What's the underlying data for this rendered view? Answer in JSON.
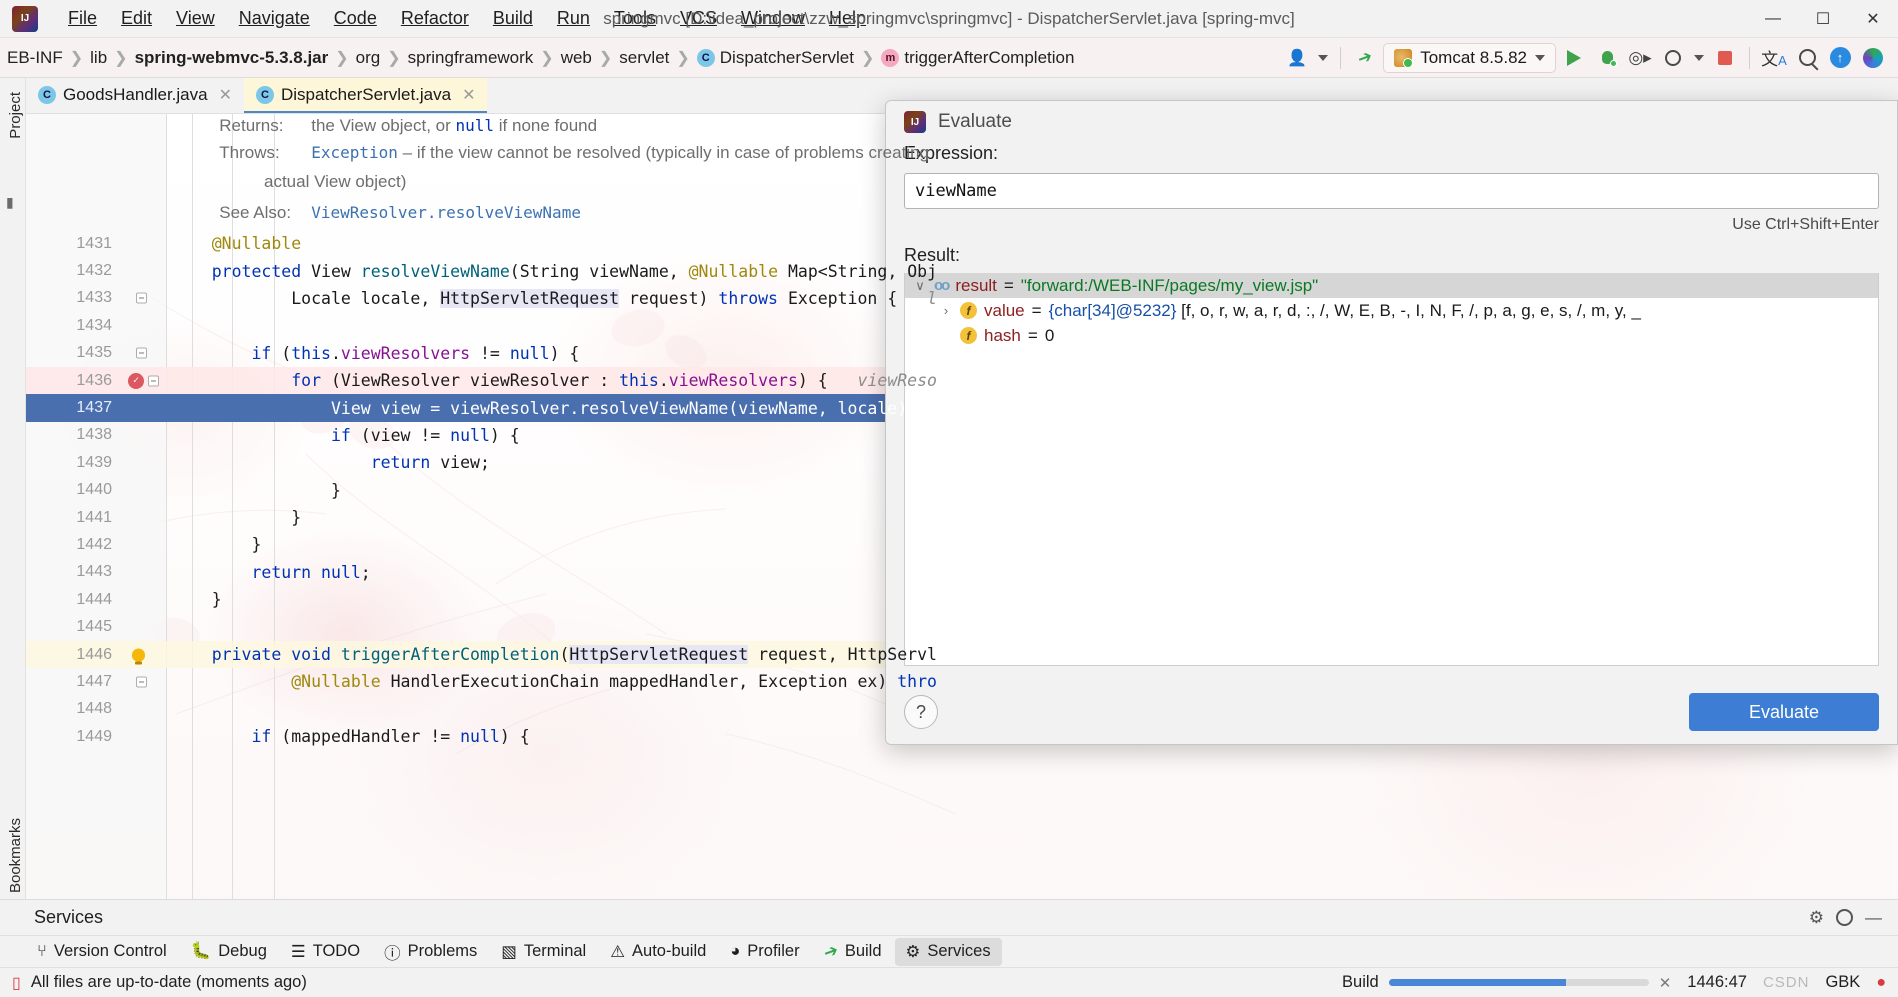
{
  "window": {
    "title": "springmvc [D:\\idea_project\\zzw_springmvc\\springmvc] - DispatcherServlet.java [spring-mvc]",
    "minimize": "—",
    "maximize": "☐",
    "close": "✕"
  },
  "menu": [
    "File",
    "Edit",
    "View",
    "Navigate",
    "Code",
    "Refactor",
    "Build",
    "Run",
    "Tools",
    "VCS",
    "Window",
    "Help"
  ],
  "breadcrumb": [
    {
      "label": "EB-INF",
      "icon": "",
      "bold": false
    },
    {
      "label": "lib",
      "icon": "",
      "bold": false
    },
    {
      "label": "spring-webmvc-5.3.8.jar",
      "icon": "",
      "bold": true
    },
    {
      "label": "org",
      "icon": "",
      "bold": false
    },
    {
      "label": "springframework",
      "icon": "",
      "bold": false
    },
    {
      "label": "web",
      "icon": "",
      "bold": false
    },
    {
      "label": "servlet",
      "icon": "",
      "bold": false
    },
    {
      "label": "DispatcherServlet",
      "icon": "c",
      "bold": false
    },
    {
      "label": "triggerAfterCompletion",
      "icon": "m",
      "bold": false
    }
  ],
  "toolbar": {
    "run_config": "Tomcat 8.5.82",
    "icons": [
      "user-icon",
      "hammer-icon",
      "run-icon",
      "debug-icon",
      "run-coverage-icon",
      "profiler-icon",
      "stop-icon",
      "translate-icon",
      "search-everywhere-icon",
      "update-project-icon",
      "plugin-icon"
    ]
  },
  "left_strip": {
    "top_tab": "Project",
    "bottom_tab": "Bookmarks"
  },
  "editor_tabs": [
    {
      "label": "GoodsHandler.java",
      "icon": "class-icon",
      "active": false
    },
    {
      "label": "DispatcherServlet.java",
      "icon": "class-icon",
      "active": true
    }
  ],
  "code": {
    "doc_lines": [
      {
        "type": "doc",
        "num": "",
        "segments": [
          {
            "t": "Returns:",
            "c": "doc-label",
            "indent": 3
          },
          {
            "t": "the View object, or null if none found",
            "c": "doc-label",
            "indent": 1
          }
        ]
      },
      {
        "type": "doc",
        "num": "",
        "segments": [
          {
            "t": "Throws:",
            "c": "doc-label",
            "indent": 3
          },
          {
            "t": "Exception",
            "c": "doc-link",
            "indent": 1
          },
          {
            "t": " – if the view cannot be resolved (typically in case of problems creating",
            "c": "doc-label",
            "indent": 0
          }
        ]
      },
      {
        "type": "doc",
        "num": "",
        "segments": [
          {
            "t": "actual View object)",
            "c": "doc-label",
            "indent": 9
          }
        ]
      },
      {
        "type": "doc",
        "num": "",
        "segments": [
          {
            "t": "See Also:",
            "c": "doc-label",
            "indent": 3
          },
          {
            "t": "ViewResolver.resolveViewName",
            "c": "doc-link",
            "indent": 1
          }
        ]
      }
    ],
    "lines": [
      {
        "num": "1431",
        "hl": "",
        "gutter": "",
        "html": "    <span class='ann'>@Nullable</span>"
      },
      {
        "num": "1432",
        "hl": "",
        "gutter": "",
        "html": "    <span class='kw'>protected</span> <span class='typ'>View</span> <span class='mth'>resolveViewName</span>(<span class='typ'>String</span> viewName, <span class='ann'>@Nullable</span> <span class='typ'>Map</span>&lt;<span class='typ'>String</span>, <span class='typ'>Obj</span>"
      },
      {
        "num": "1433",
        "hl": "",
        "gutter": "fold",
        "html": "            <span class='typ'>Locale</span> locale, <span class='hlref'>HttpServletRequest</span> request) <span class='kw'>throws</span> <span class='typ'>Exception</span> {   <span class='cmt'>l</span>"
      },
      {
        "num": "1434",
        "hl": "",
        "gutter": "",
        "html": ""
      },
      {
        "num": "1435",
        "hl": "",
        "gutter": "fold",
        "html": "        <span class='kw'>if</span> (<span class='kw'>this</span>.<span class='fld'>viewResolvers</span> != <span class='kw'>null</span>) {"
      },
      {
        "num": "1436",
        "hl": "pink",
        "gutter": "breakpoint-fold",
        "html": "            <span class='kw'>for</span> (<span class='typ'>ViewResolver</span> viewResolver : <span class='kw'>this</span>.<span class='fld'>viewResolvers</span>) {   <span class='cmt'>viewReso</span>"
      },
      {
        "num": "1437",
        "hl": "exec",
        "gutter": "",
        "html": "                <span class='typ'>View</span> view = viewResolver.<span class='mth'>resolveViewName</span>(viewName, locale);"
      },
      {
        "num": "1438",
        "hl": "",
        "gutter": "",
        "html": "                <span class='kw'>if</span> (view != <span class='kw'>null</span>) {"
      },
      {
        "num": "1439",
        "hl": "",
        "gutter": "",
        "html": "                    <span class='kw'>return</span> view;"
      },
      {
        "num": "1440",
        "hl": "",
        "gutter": "",
        "html": "                }"
      },
      {
        "num": "1441",
        "hl": "",
        "gutter": "",
        "html": "            }"
      },
      {
        "num": "1442",
        "hl": "",
        "gutter": "",
        "html": "        }"
      },
      {
        "num": "1443",
        "hl": "",
        "gutter": "",
        "html": "        <span class='kw'>return</span> <span class='kw'>null</span>;"
      },
      {
        "num": "1444",
        "hl": "",
        "gutter": "",
        "html": "    }"
      },
      {
        "num": "1445",
        "hl": "",
        "gutter": "",
        "html": ""
      },
      {
        "num": "1446",
        "hl": "yellow",
        "gutter": "bulb",
        "html": "    <span class='kw'>private</span> <span class='kw'>void</span> <span class='mth'>triggerAfterCompletion</span>(<span class='hlref'>HttpServletRequest</span> request, <span class='typ'>HttpServl</span>"
      },
      {
        "num": "1447",
        "hl": "",
        "gutter": "fold",
        "html": "            <span class='ann'>@Nullable</span> <span class='typ'>HandlerExecutionChain</span> mappedHandler, <span class='typ'>Exception</span> ex) <span class='kw'>thro</span>"
      },
      {
        "num": "1448",
        "hl": "",
        "gutter": "",
        "html": ""
      },
      {
        "num": "1449",
        "hl": "",
        "gutter": "",
        "html": "        <span class='kw'>if</span> (mappedHandler != <span class='kw'>null</span>) {"
      }
    ]
  },
  "dialog": {
    "title": "Evaluate",
    "expression_label": "Expression:",
    "expression_value": "viewName",
    "hint": "Use Ctrl+Shift+Enter",
    "result_label": "Result:",
    "tree": [
      {
        "depth": 0,
        "twisty": "∨",
        "icon": "oo",
        "name": "result",
        "eq": "=",
        "value": "\"forward:/WEB-INF/pages/my_view.jsp\"",
        "value_class": "tn-str",
        "selected": true
      },
      {
        "depth": 1,
        "twisty": "›",
        "icon": "f",
        "name": "value",
        "eq": "=",
        "value": "{char[34]@5232} [f, o, r, w, a, r, d, :, /, W, E, B, -, I, N, F, /, p, a, g, e, s, /, m, y, _",
        "value_class": "tn-obj",
        "selected": false
      },
      {
        "depth": 1,
        "twisty": "",
        "icon": "f",
        "name": "hash",
        "eq": "=",
        "value": "0",
        "value_class": "tn-obj",
        "selected": false
      }
    ],
    "help_label": "?",
    "evaluate_button": "Evaluate"
  },
  "services": {
    "title": "Services",
    "icons": [
      "settings-icon",
      "gear-icon",
      "minimize-icon"
    ]
  },
  "bottom_windows": [
    {
      "label": "Version Control",
      "icon": "⎇",
      "active": false
    },
    {
      "label": "Debug",
      "icon": "⚙",
      "active": false
    },
    {
      "label": "TODO",
      "icon": "☰",
      "active": false
    },
    {
      "label": "Problems",
      "icon": "❗",
      "active": false
    },
    {
      "label": "Terminal",
      "icon": "▣",
      "active": false
    },
    {
      "label": "Auto-build",
      "icon": "⚠",
      "active": false
    },
    {
      "label": "Profiler",
      "icon": "◔",
      "active": false
    },
    {
      "label": "Build",
      "icon": "🔨",
      "active": false
    },
    {
      "label": "Services",
      "icon": "⚙",
      "active": true
    }
  ],
  "status": {
    "message": "All files are up-to-date (moments ago)",
    "build_label": "Build",
    "caret": "1446:47",
    "encoding": "GBK",
    "watermark": "CSDN",
    "progress_percent": 68
  }
}
